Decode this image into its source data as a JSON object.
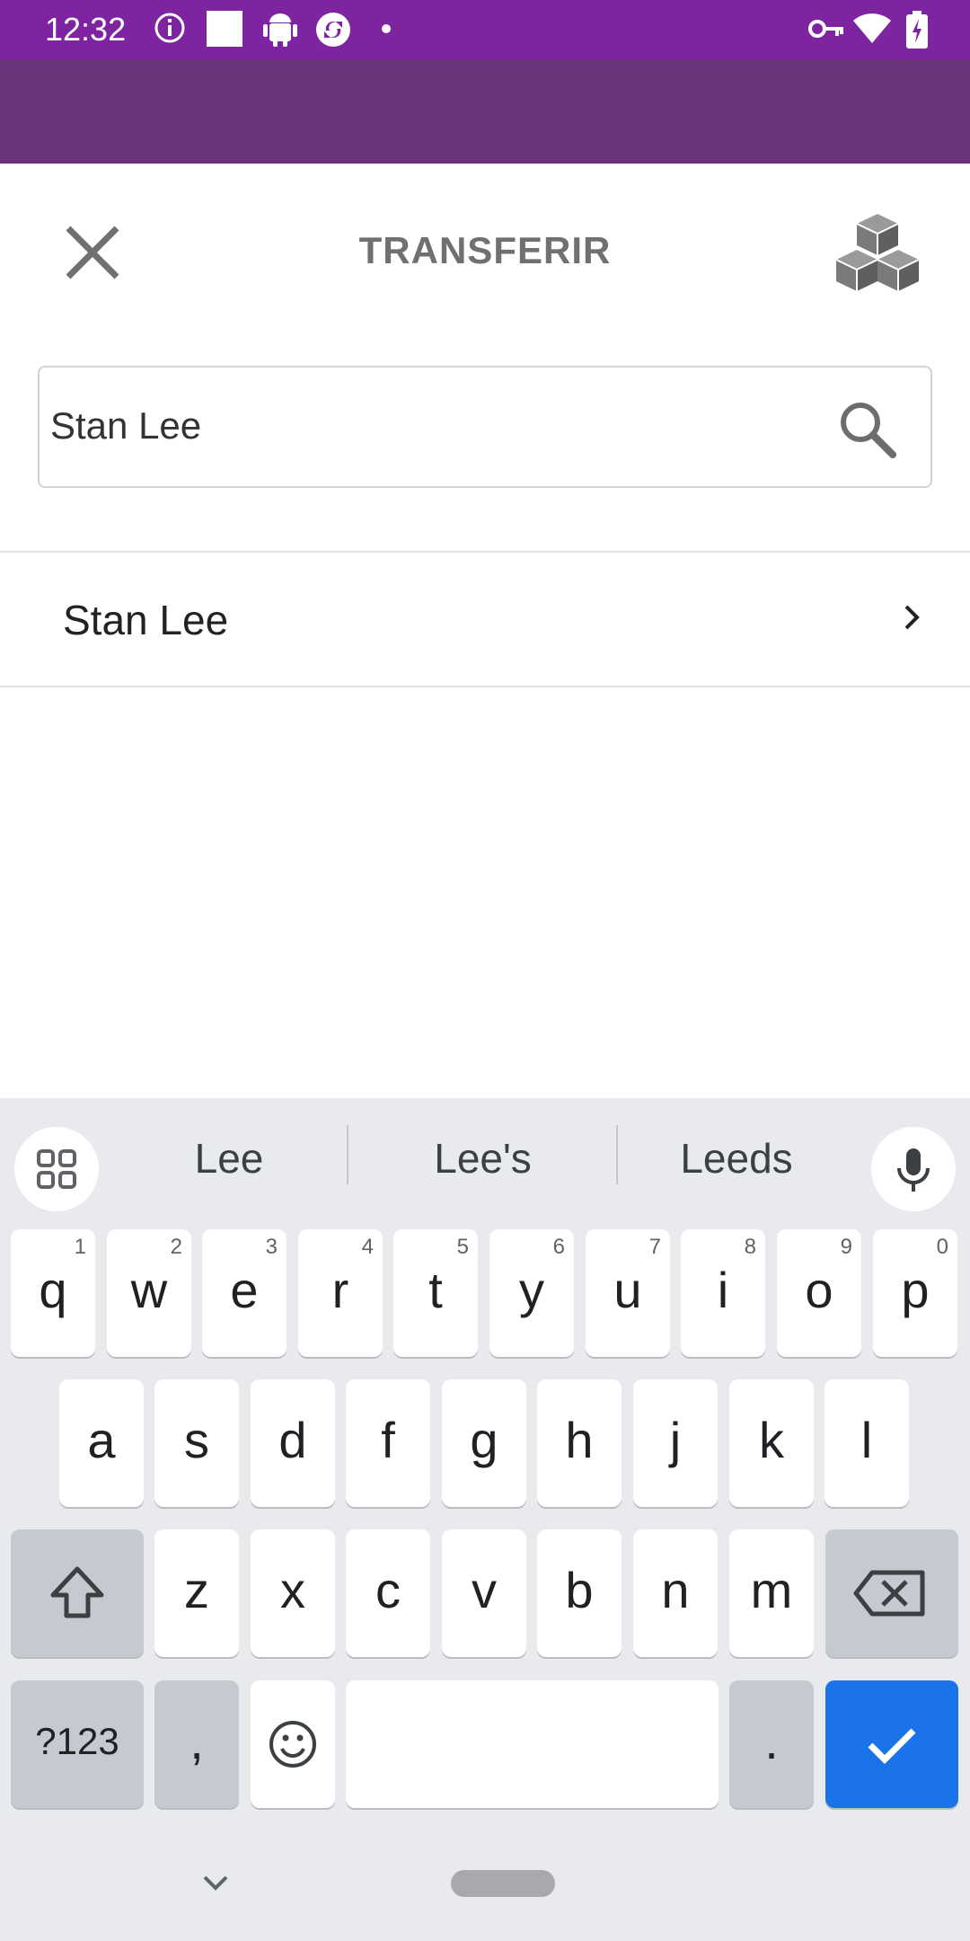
{
  "status_bar": {
    "time": "12:32",
    "icons_left": [
      "info-icon",
      "square-icon",
      "android-icon",
      "sync-icon",
      "dot-icon"
    ],
    "icons_right": [
      "vpn-key-icon",
      "wifi-icon",
      "battery-charging-icon"
    ]
  },
  "header": {
    "title": "TRANSFERIR",
    "close_icon": "close-icon",
    "cubes_icon": "cubes-icon"
  },
  "search": {
    "value": "Stan Lee",
    "icon": "search-icon"
  },
  "results": [
    {
      "label": "Stan Lee"
    }
  ],
  "keyboard": {
    "suggestions": [
      "Lee",
      "Lee's",
      "Leeds"
    ],
    "row1": [
      {
        "ch": "q",
        "num": "1"
      },
      {
        "ch": "w",
        "num": "2"
      },
      {
        "ch": "e",
        "num": "3"
      },
      {
        "ch": "r",
        "num": "4"
      },
      {
        "ch": "t",
        "num": "5"
      },
      {
        "ch": "y",
        "num": "6"
      },
      {
        "ch": "u",
        "num": "7"
      },
      {
        "ch": "i",
        "num": "8"
      },
      {
        "ch": "o",
        "num": "9"
      },
      {
        "ch": "p",
        "num": "0"
      }
    ],
    "row2": [
      "a",
      "s",
      "d",
      "f",
      "g",
      "h",
      "j",
      "k",
      "l"
    ],
    "row3": [
      "z",
      "x",
      "c",
      "v",
      "b",
      "n",
      "m"
    ],
    "symbols_label": "?123",
    "comma": ",",
    "period": ".",
    "accent_color": "#1a73e8"
  },
  "colors": {
    "status_bar": "#7e24a0",
    "app_bar": "#6a337a"
  }
}
